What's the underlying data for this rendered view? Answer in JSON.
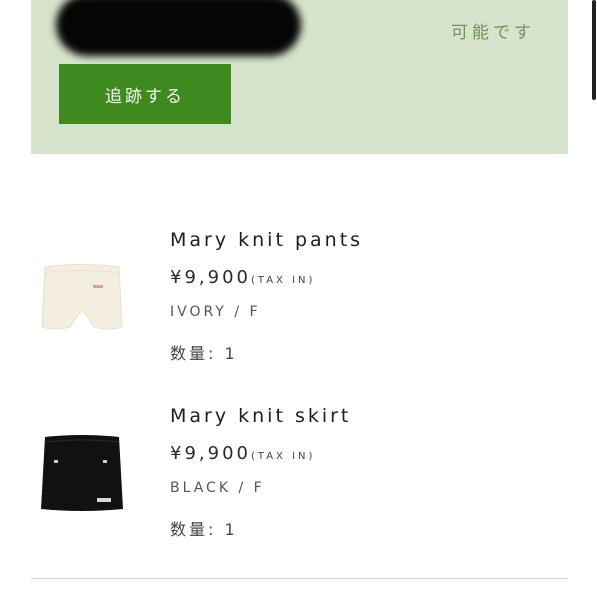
{
  "tracking": {
    "availability_text": "可能です",
    "track_button_label": "追跡する"
  },
  "products": [
    {
      "name": "Mary knit pants",
      "price": "¥9,900",
      "tax_note": "(TAX IN)",
      "variant": "IVORY / F",
      "quantity": "数量: 1"
    },
    {
      "name": "Mary knit skirt",
      "price": "¥9,900",
      "tax_note": "(TAX IN)",
      "variant": "BLACK / F",
      "quantity": "数量: 1"
    }
  ],
  "colors": {
    "panel_background": "#d6e4cc",
    "button_green": "#3f8a1f",
    "availability_green": "#6f9657"
  }
}
